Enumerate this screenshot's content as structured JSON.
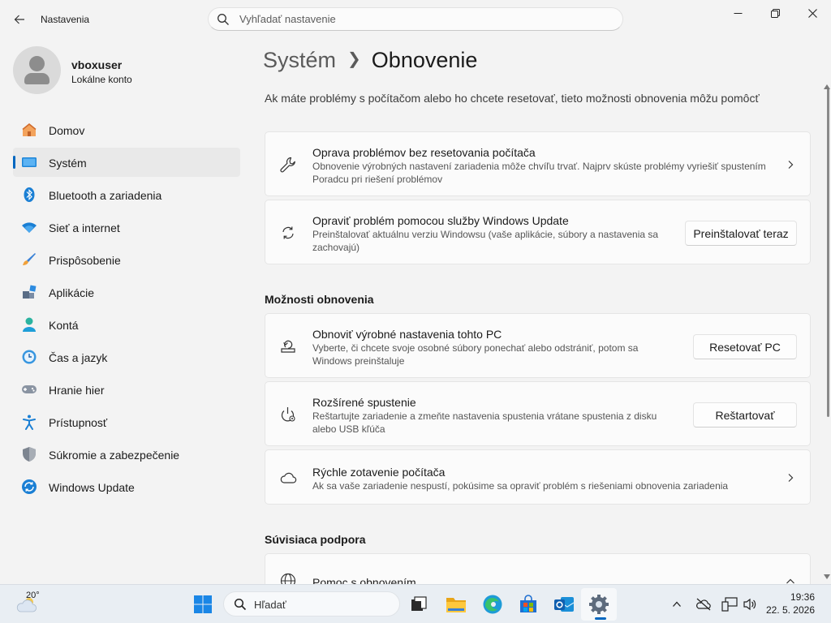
{
  "titlebar": {
    "app_title": "Nastavenia",
    "search_placeholder": "Vyhľadať nastavenie"
  },
  "profile": {
    "name": "vboxuser",
    "account_type": "Lokálne konto"
  },
  "sidebar": {
    "items": [
      {
        "label": "Domov",
        "icon": "home-icon"
      },
      {
        "label": "Systém",
        "icon": "system-icon",
        "active": true
      },
      {
        "label": "Bluetooth a zariadenia",
        "icon": "bluetooth-icon"
      },
      {
        "label": "Sieť a internet",
        "icon": "wifi-icon"
      },
      {
        "label": "Prispôsobenie",
        "icon": "brush-icon"
      },
      {
        "label": "Aplikácie",
        "icon": "apps-icon"
      },
      {
        "label": "Kontá",
        "icon": "accounts-icon"
      },
      {
        "label": "Čas a jazyk",
        "icon": "time-language-icon"
      },
      {
        "label": "Hranie hier",
        "icon": "gaming-icon"
      },
      {
        "label": "Prístupnosť",
        "icon": "accessibility-icon"
      },
      {
        "label": "Súkromie a zabezpečenie",
        "icon": "shield-icon"
      },
      {
        "label": "Windows Update",
        "icon": "windows-update-icon"
      }
    ]
  },
  "main": {
    "breadcrumb_parent": "Systém",
    "breadcrumb_current": "Obnovenie",
    "intro": "Ak máte problémy s počítačom alebo ho chcete resetovať, tieto možnosti obnovenia môžu pomôcť",
    "cards": [
      {
        "title": "Oprava problémov bez resetovania počítača",
        "desc_line1": "Obnovenie výrobných nastavení zariadenia môže chvíľu trvať. Najprv skúste problémy vyriešiť spustením",
        "desc_line2": "Poradcu pri riešení problémov"
      },
      {
        "title": "Opraviť problém pomocou služby Windows Update",
        "desc_line1": "Preinštalovať aktuálnu verziu Windowsu (vaše aplikácie, súbory a nastavenia sa",
        "desc_line2": "zachovajú)",
        "button": "Preinštalovať teraz"
      }
    ],
    "section_recovery": "Možnosti obnovenia",
    "recovery_cards": [
      {
        "title": "Obnoviť výrobné nastavenia tohto PC",
        "desc_line1": "Vyberte, či chcete svoje osobné súbory ponechať alebo odstrániť, potom sa",
        "desc_line2": "Windows preinštaluje",
        "button": "Resetovať PC"
      },
      {
        "title": "Rozšírené spustenie",
        "desc_line1": "Reštartujte zariadenie a zmeňte nastavenia spustenia vrátane spustenia z disku",
        "desc_line2": "alebo USB kľúča",
        "button": "Reštartovať"
      },
      {
        "title": "Rýchle zotavenie počítača",
        "desc_line1": "Ak sa vaše zariadenie nespustí, pokúsime sa opraviť problém s riešeniami obnovenia zariadenia"
      }
    ],
    "section_support": "Súvisiaca podpora",
    "support_cards": [
      {
        "title": "Pomoc s obnovením"
      }
    ]
  },
  "taskbar": {
    "weather_temp": "20°",
    "search_label": "Hľadať",
    "time": "19:36",
    "date": "22. 5. 2026"
  },
  "colors": {
    "accent": "#0067c0",
    "background": "#f3f3f3",
    "card": "#fbfbfb"
  }
}
